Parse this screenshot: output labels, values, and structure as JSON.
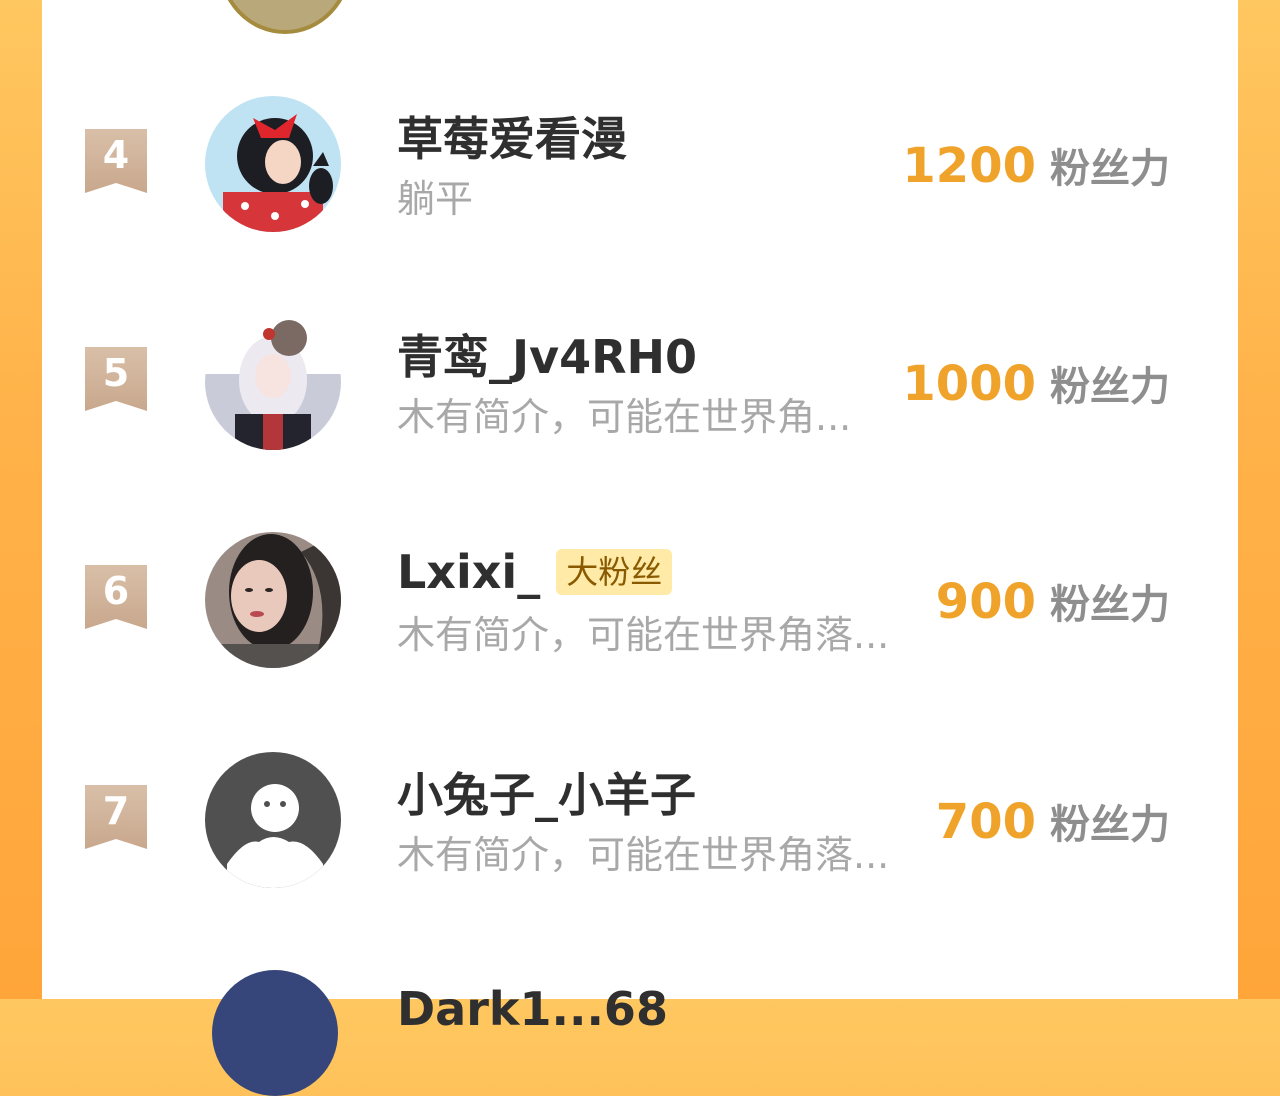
{
  "colors": {
    "accent": "#f0a32a",
    "name": "#2f2f2f",
    "bio": "#a8a8a8",
    "label": "#8e8e8e",
    "badge_bg": "#ffeaa7"
  },
  "fan_label": "粉丝力",
  "rows": [
    {
      "rank": "4",
      "name": "草莓爱看漫",
      "bio": "躺平",
      "fans": "1200",
      "badge": ""
    },
    {
      "rank": "5",
      "name": "青鸾_Jv4RH0",
      "bio": "木有简介，可能在世界角...",
      "fans": "1000",
      "badge": ""
    },
    {
      "rank": "6",
      "name": "Lxixi_",
      "bio": "木有简介，可能在世界角落...",
      "fans": "900",
      "badge": "大粉丝"
    },
    {
      "rank": "7",
      "name": "小兔子_小羊子",
      "bio": "木有简介，可能在世界角落...",
      "fans": "700",
      "badge": ""
    }
  ],
  "partial_next_name": "Dark1...68"
}
